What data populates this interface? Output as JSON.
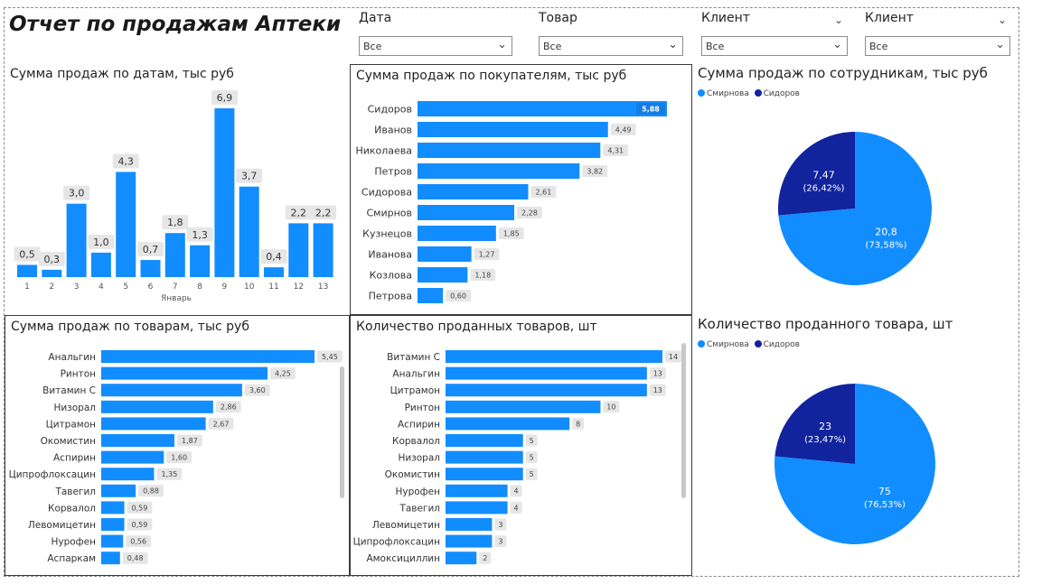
{
  "title": "Отчет по продажам Аптеки",
  "colors": {
    "primary": "#118dff",
    "secondary": "#12239e",
    "label_bg": "#e6e6e6"
  },
  "slicers": [
    {
      "label": "Дата",
      "value": "Все",
      "has_header_chevron": false
    },
    {
      "label": "Товар",
      "value": "Все",
      "has_header_chevron": false
    },
    {
      "label": "Клиент",
      "value": "Все",
      "has_header_chevron": true
    },
    {
      "label": "Клиент",
      "value": "Все",
      "has_header_chevron": true
    }
  ],
  "chart_data": [
    {
      "id": "by_date",
      "type": "bar",
      "title": "Сумма продаж по датам, тыс руб",
      "xlabel": "Январь",
      "categories": [
        "1",
        "2",
        "3",
        "4",
        "5",
        "6",
        "7",
        "8",
        "9",
        "10",
        "11",
        "12",
        "13"
      ],
      "values": [
        0.5,
        0.3,
        3.0,
        1.0,
        4.3,
        0.7,
        1.8,
        1.3,
        6.9,
        3.7,
        0.4,
        2.2,
        2.2
      ],
      "labels": [
        "0,5",
        "0,3",
        "3,0",
        "1,0",
        "4,3",
        "0,7",
        "1,8",
        "1,3",
        "6,9",
        "3,7",
        "0,4",
        "2,2",
        "2,2"
      ],
      "ylim": [
        0,
        6.9
      ]
    },
    {
      "id": "by_customer",
      "type": "bar",
      "orientation": "horizontal",
      "title": "Сумма продаж по покупателям, тыс руб",
      "categories": [
        "Сидоров",
        "Иванов",
        "Николаева",
        "Петров",
        "Сидорова",
        "Смирнов",
        "Кузнецов",
        "Иванова",
        "Козлова",
        "Петрова"
      ],
      "values": [
        5.88,
        4.49,
        4.31,
        3.82,
        2.61,
        2.28,
        1.85,
        1.27,
        1.18,
        0.6
      ],
      "labels": [
        "5,88",
        "4,49",
        "4,31",
        "3,82",
        "2,61",
        "2,28",
        "1,85",
        "1,27",
        "1,18",
        "0,60"
      ],
      "max": 5.88
    },
    {
      "id": "by_employee_sum",
      "type": "pie",
      "title": "Сумма продаж по сотрудникам, тыс руб",
      "legend": [
        "Смирнова",
        "Сидоров"
      ],
      "legend_position": "top-left",
      "values": [
        20.8,
        7.47
      ],
      "percent": [
        73.58,
        26.42
      ],
      "value_labels": [
        "20,8",
        "7,47"
      ],
      "percent_labels": [
        "(73,58%)",
        "(26,42%)"
      ]
    },
    {
      "id": "by_product_sum",
      "type": "bar",
      "orientation": "horizontal",
      "title": "Сумма продаж по товарам, тыс руб",
      "categories": [
        "Анальгин",
        "Ринтон",
        "Витамин С",
        "Низорал",
        "Цитрамон",
        "Окомистин",
        "Аспирин",
        "Ципрофлоксацин",
        "Тавегил",
        "Корвалол",
        "Левомицетин",
        "Нурофен",
        "Аспаркам"
      ],
      "values": [
        5.45,
        4.25,
        3.6,
        2.86,
        2.67,
        1.87,
        1.6,
        1.35,
        0.88,
        0.59,
        0.59,
        0.56,
        0.48
      ],
      "labels": [
        "5,45",
        "4,25",
        "3,60",
        "2,86",
        "2,67",
        "1,87",
        "1,60",
        "1,35",
        "0,88",
        "0,59",
        "0,59",
        "0,56",
        "0,48"
      ],
      "max": 5.45
    },
    {
      "id": "by_product_qty",
      "type": "bar",
      "orientation": "horizontal",
      "title": "Количество проданных товаров, шт",
      "categories": [
        "Витамин С",
        "Анальгин",
        "Цитрамон",
        "Ринтон",
        "Аспирин",
        "Корвалол",
        "Низорал",
        "Окомистин",
        "Нурофен",
        "Тавегил",
        "Левомицетин",
        "Ципрофлоксацин",
        "Амоксициллин"
      ],
      "values": [
        14,
        13,
        13,
        10,
        8,
        5,
        5,
        5,
        4,
        4,
        3,
        3,
        2
      ],
      "labels": [
        "14",
        "13",
        "13",
        "10",
        "8",
        "5",
        "5",
        "5",
        "4",
        "4",
        "3",
        "3",
        "2"
      ],
      "max": 14
    },
    {
      "id": "by_employee_qty",
      "type": "pie",
      "title": "Количество проданного товара, шт",
      "legend": [
        "Смирнова",
        "Сидоров"
      ],
      "legend_position": "top-left",
      "values": [
        75,
        23
      ],
      "percent": [
        76.53,
        23.47
      ],
      "value_labels": [
        "75",
        "23"
      ],
      "percent_labels": [
        "(76,53%)",
        "(23,47%)"
      ]
    }
  ]
}
